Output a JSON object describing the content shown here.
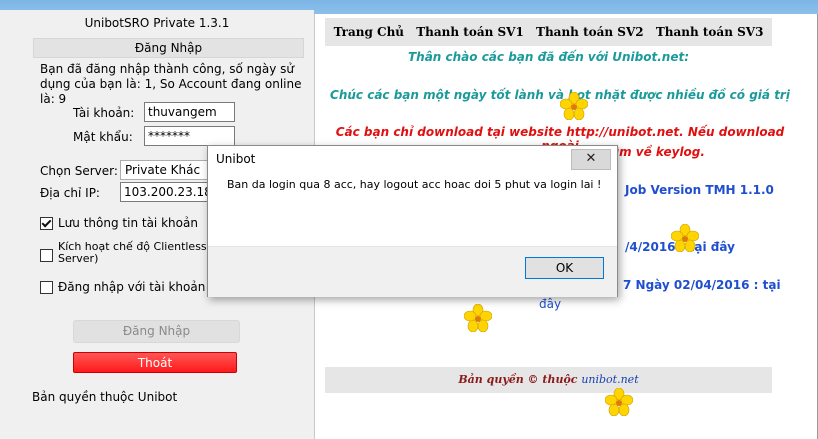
{
  "app": {
    "title": "UnibotSRO Private 1.3.1",
    "login_header": "Đăng Nhập",
    "success_message": "Bạn đã đăng nhập thành công, số ngày sử dụng của bạn là: 1, So Account đang online là: 9",
    "account_label": "Tài khoản:",
    "account_value": "thuvangem",
    "password_label": "Mật khẩu:",
    "password_value": "*******",
    "server_label": "Chọn Server:",
    "server_value": "Private Khác",
    "ip_label": "Địa chỉ IP:",
    "ip_value": "103.200.23.18",
    "save_info_label": "Lưu thông tin tài khoản",
    "save_info_checked": true,
    "clientless_label": "Kích hoạt chế độ Clientless Server)",
    "clientless_checked": false,
    "login_with_label": "Đăng nhập với tài khoản qu",
    "login_with_checked": false,
    "login_button": "Đăng Nhập",
    "exit_button": "Thoát",
    "copyright": "Bản quyền thuộc Unibot"
  },
  "web": {
    "nav": [
      "Trang Chủ",
      "Thanh toán SV1",
      "Thanh toán SV2",
      "Thanh toán SV3"
    ],
    "welcome": "Thân chào các bạn đã đến với Unibot.net:",
    "wish": "Chúc các bạn một ngày tốt lành và bot nhặt được nhiều đồ có giá trị",
    "warning_line1": "Các bạn chỉ download tại website http://unibot.net. Nếu download ngoài",
    "warning_line2": "ìm về keylog.",
    "version_text": "Job Version TMH 1.1.0",
    "date1_text": "/4/2016 : tại đây",
    "date2_text": "7 Ngày 02/04/2016 : tại",
    "date2_link": "đây",
    "footer_prefix": "Bản quyền © thuộc",
    "footer_link": "unibot.net"
  },
  "dialog": {
    "title": "Unibot",
    "close_label": "✕",
    "message": "Ban da login qua 8 acc, hay logout acc hoac doi 5 phut va login lai !",
    "ok_label": "OK"
  },
  "colors": {
    "exit_button": "#ff2a2a",
    "teal_text": "#1a9a9a",
    "red_text": "#e01010",
    "blue_text": "#1f4fd0",
    "flower": "#ffd400"
  }
}
